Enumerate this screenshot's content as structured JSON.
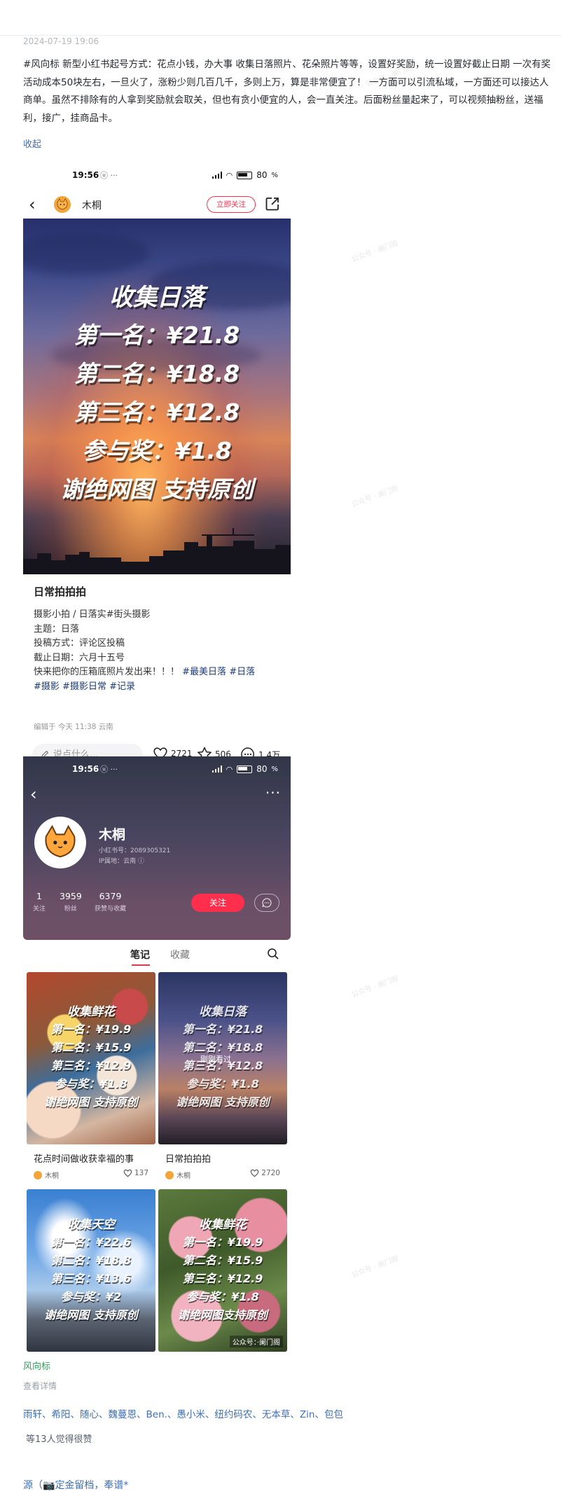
{
  "post": {
    "date": "2024-07-19 19:06",
    "body": "#风向标 新型小红书起号方式：花点小钱，办大事 收集日落照片、花朵照片等等，设置好奖励，统一设置好截止日期 一次有奖活动成本50块左右，一旦火了，涨粉少则几百几千，多则上万，算是非常便宜了！ 一方面可以引流私域，一方面还可以接达人商单。虽然不排除有的人拿到奖励就会取关，但也有贪小便宜的人，会一直关注。后面粉丝量起来了，可以视频抽粉丝，送福利，接广，挂商品卡。",
    "collapse": "收起"
  },
  "phone1": {
    "status_time": "19:56",
    "status_battery": "80",
    "author": "木桐",
    "follow_label": "立即关注",
    "overlay": [
      "收集日落",
      "第一名：¥21.8",
      "第二名：¥18.8",
      "第三名：¥12.8",
      "参与奖：¥1.8",
      "谢绝网图 支持原创"
    ],
    "title": "日常拍拍拍",
    "lines": [
      "摄影小拍 / 日落实#街头摄影",
      "主题：日落",
      "投稿方式：评论区投稿",
      "截止日期：六月十五号"
    ],
    "line5_prefix": "快来把你的压箱底照片发出来！！！",
    "tags": [
      "#最美日落",
      "#日落",
      "#摄影",
      "#摄影日常",
      "#记录"
    ],
    "edit_meta": "编辑于 今天 11:38 云南",
    "comment_placeholder": "说点什么...",
    "likes": "2721",
    "stars": "506",
    "comments": "1.4万"
  },
  "phone2": {
    "status_time": "19:56",
    "status_battery": "80",
    "name": "木桐",
    "xhs_id": "小红书号：2089305321",
    "ip": "IP属地：云南 ⓘ",
    "stats": [
      {
        "n": "1",
        "l": "关注"
      },
      {
        "n": "3959",
        "l": "粉丝"
      },
      {
        "n": "6379",
        "l": "获赞与收藏"
      }
    ],
    "follow_label": "关注",
    "tabs": [
      "笔记",
      "收藏"
    ],
    "cards": [
      {
        "overlay": [
          "收集鲜花",
          "第一名：¥19.9",
          "第二名：¥15.9",
          "第三名：¥12.9",
          "参与奖：¥1.8",
          "谢绝网图 支持原创"
        ],
        "title": "花点时间做收获幸福的事",
        "author": "木桐",
        "likes": "137"
      },
      {
        "overlay": [
          "收集日落",
          "第一名：¥21.8",
          "第二名：¥18.8",
          "第三名：¥12.8",
          "参与奖：¥1.8",
          "谢绝网图 支持原创"
        ],
        "badge": "刚刚看过",
        "title": "日常拍拍拍",
        "author": "木桐",
        "likes": "2720"
      },
      {
        "overlay": [
          "收集天空",
          "第一名：¥22.6",
          "第二名：¥18.8",
          "第三名：¥13.6",
          "参与奖：¥2",
          "谢绝网图 支持原创"
        ]
      },
      {
        "overlay": [
          "收集鲜花",
          "第一名：¥19.9",
          "第二名：¥15.9",
          "第三名：¥12.9",
          "参与奖：¥1.8",
          "谢绝网图支持原创"
        ],
        "watermark": "公众号：·阑门阁"
      }
    ]
  },
  "footer": {
    "source": "风向标",
    "details": "查看详情",
    "likers": "雨轩、希阳、随心、魏蔓恩、Ben.、愚小米、纽约码农、无本草、Zin、包包",
    "likers_count": "等13人觉得很赞",
    "source_prefix": "源（",
    "source_text": "定金留档，奉谱*"
  },
  "watermark": "公众号 · 阑门阁",
  "colors": {
    "accent_red": "#ff2e4d",
    "link_blue": "#3e6fb6",
    "source_green": "#2aa45c"
  }
}
